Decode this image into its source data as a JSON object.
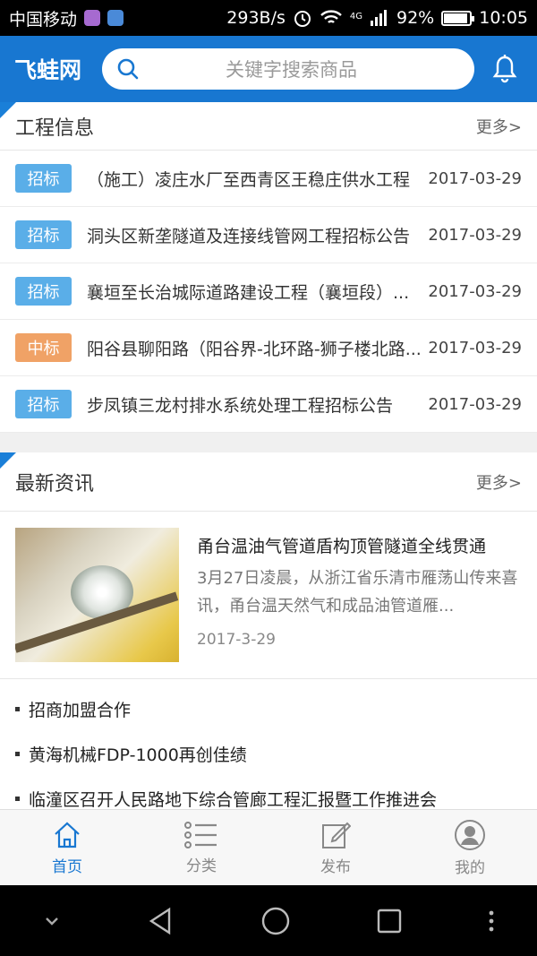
{
  "status_bar": {
    "carrier": "中国移动",
    "speed": "293B/s",
    "network": "4G",
    "battery": "92%",
    "battery_level": 0.92,
    "time": "10:05"
  },
  "header": {
    "logo": "飞蛙网",
    "search_placeholder": "关键字搜索商品",
    "accent_color": "#1877d1"
  },
  "projects": {
    "title": "工程信息",
    "more": "更多>",
    "items": [
      {
        "tag": "招标",
        "type": "bid",
        "title": "（施工）凌庄水厂至西青区王稳庄供水工程",
        "date": "2017-03-29"
      },
      {
        "tag": "招标",
        "type": "bid",
        "title": "洞头区新垄隧道及连接线管网工程招标公告",
        "date": "2017-03-29"
      },
      {
        "tag": "招标",
        "type": "bid",
        "title": "襄垣至长治城际道路建设工程（襄垣段）...",
        "date": "2017-03-29"
      },
      {
        "tag": "中标",
        "type": "win",
        "title": "阳谷县聊阳路（阳谷界-北环路-狮子楼北路...",
        "date": "2017-03-29"
      },
      {
        "tag": "招标",
        "type": "bid",
        "title": "步凤镇三龙村排水系统处理工程招标公告",
        "date": "2017-03-29"
      }
    ]
  },
  "news": {
    "title": "最新资讯",
    "more": "更多>",
    "featured": {
      "title": "甬台温油气管道盾构顶管隧道全线贯通",
      "desc": "3月27日凌晨，从浙江省乐清市雁荡山传来喜讯，甬台温天然气和成品油管道雁...",
      "date": "2017-3-29"
    },
    "list": [
      "招商加盟合作",
      "黄海机械FDP-1000再创佳绩",
      "临潼区召开人民路地下综合管廊工程汇报暨工作推进会"
    ]
  },
  "tabs": [
    {
      "label": "首页",
      "icon": "home-icon",
      "active": true
    },
    {
      "label": "分类",
      "icon": "list-icon",
      "active": false
    },
    {
      "label": "发布",
      "icon": "edit-icon",
      "active": false
    },
    {
      "label": "我的",
      "icon": "user-icon",
      "active": false
    }
  ]
}
